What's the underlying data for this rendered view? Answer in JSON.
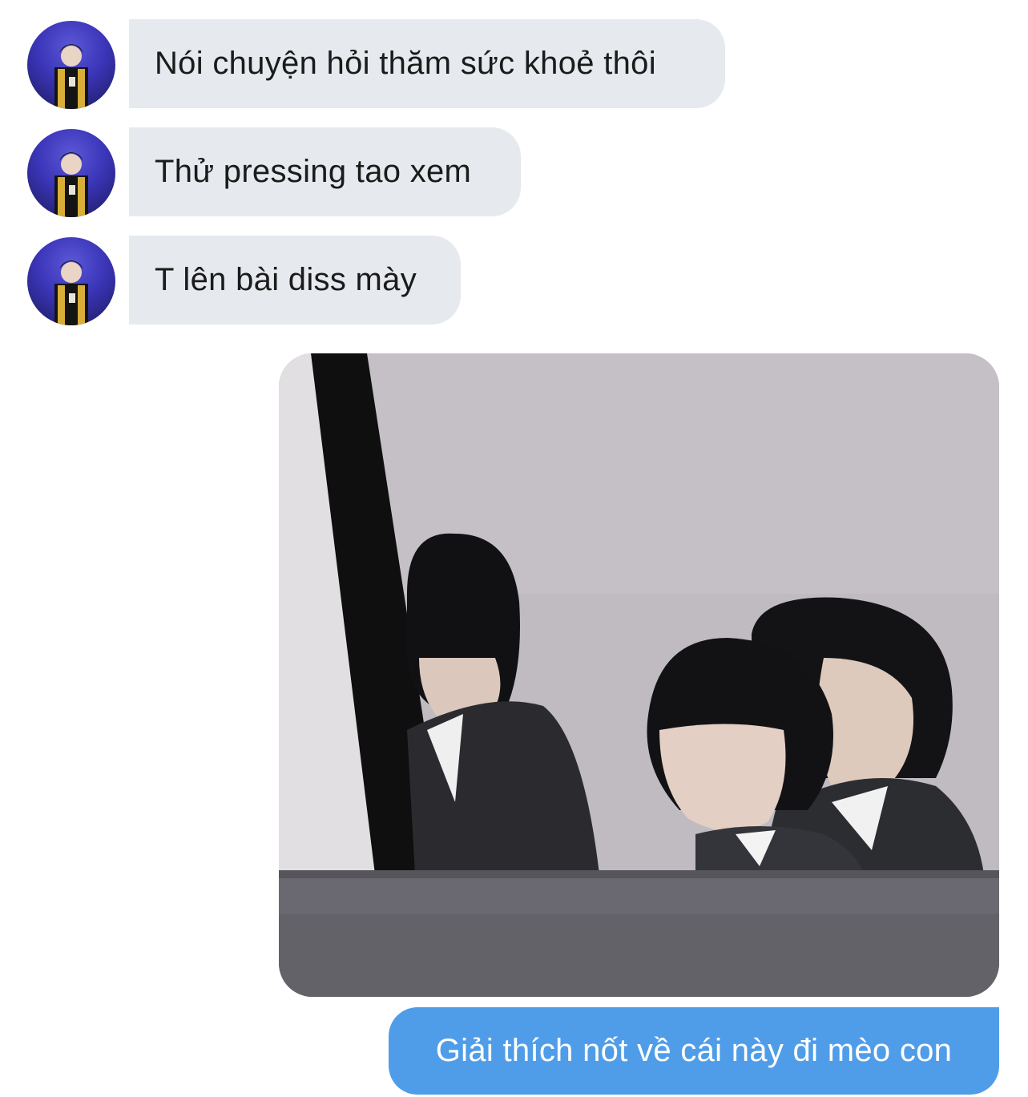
{
  "chat": {
    "incoming": [
      {
        "text": "Nói chuyện hỏi thăm sức khoẻ thôi"
      },
      {
        "text": "Thử pressing tao xem"
      },
      {
        "text": "T lên bài diss mày"
      }
    ],
    "outgoing": [
      {
        "text": "Giải thích nốt về cái này đi mèo con"
      }
    ]
  },
  "colors": {
    "incoming_bubble": "#e6e9ed",
    "outgoing_bubble": "#4f9de8",
    "incoming_text": "#1b1b1b",
    "outgoing_text": "#ffffff"
  },
  "icons": {
    "avatar": "profile-photo",
    "attachment": "photo-three-people-in-suits"
  }
}
